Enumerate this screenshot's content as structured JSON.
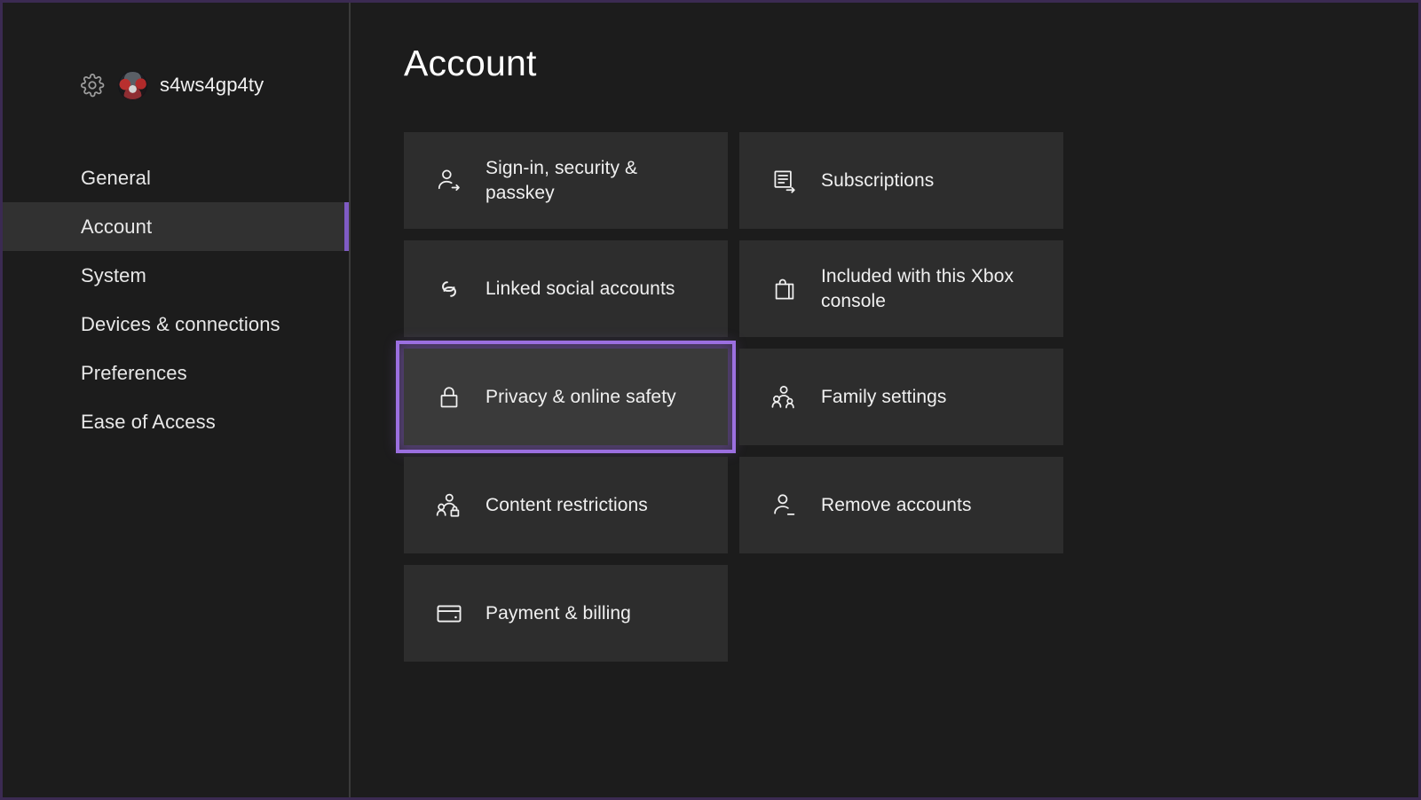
{
  "window": {
    "background_color": "#1c1c1c",
    "frame_color": "#3b2a52",
    "accent_color": "#9b6fe0",
    "tile_color": "#2d2d2d"
  },
  "sidebar": {
    "gear_icon": "gear-icon",
    "avatar_icon": "avatar",
    "profile_name": "s4ws4gp4ty",
    "items": [
      {
        "label": "General",
        "selected": false
      },
      {
        "label": "Account",
        "selected": true
      },
      {
        "label": "System",
        "selected": false
      },
      {
        "label": "Devices & connections",
        "selected": false
      },
      {
        "label": "Preferences",
        "selected": false
      },
      {
        "label": "Ease of Access",
        "selected": false
      }
    ]
  },
  "main": {
    "title": "Account",
    "tiles": [
      {
        "label": "Sign-in, security & passkey",
        "icon": "person-arrow-icon",
        "focused": false
      },
      {
        "label": "Subscriptions",
        "icon": "document-arrow-icon",
        "focused": false
      },
      {
        "label": "Linked social accounts",
        "icon": "link-icon",
        "focused": false
      },
      {
        "label": "Included with this Xbox console",
        "icon": "shopping-bag-icon",
        "focused": false
      },
      {
        "label": "Privacy & online safety",
        "icon": "lock-icon",
        "focused": true
      },
      {
        "label": "Family settings",
        "icon": "people-group-icon",
        "focused": false
      },
      {
        "label": "Content restrictions",
        "icon": "people-lock-icon",
        "focused": false
      },
      {
        "label": "Remove accounts",
        "icon": "person-minus-icon",
        "focused": false
      },
      {
        "label": "Payment & billing",
        "icon": "credit-card-icon",
        "focused": false
      }
    ]
  }
}
